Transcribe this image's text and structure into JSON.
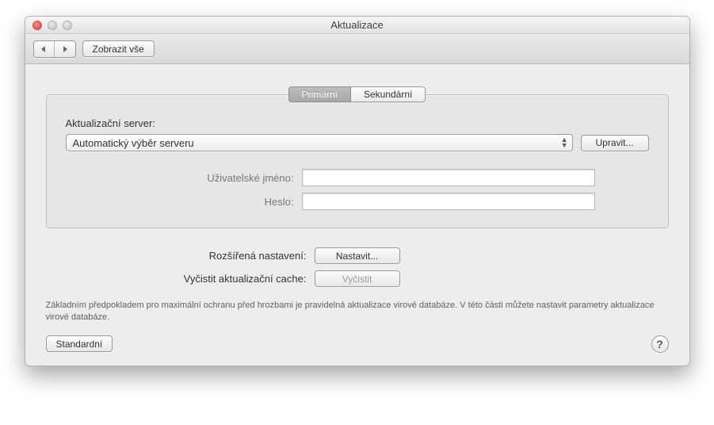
{
  "window": {
    "title": "Aktualizace"
  },
  "toolbar": {
    "show_all_label": "Zobrazit vše"
  },
  "tabs": {
    "primary": "Primární",
    "secondary": "Sekundární"
  },
  "panel": {
    "server_label": "Aktualizační server:",
    "server_value": "Automatický výběr serveru",
    "edit_label": "Upravit...",
    "username_label": "Uživatelské jméno:",
    "password_label": "Heslo:",
    "username_value": "",
    "password_value": ""
  },
  "lower": {
    "advanced_label": "Rozšířená nastavení:",
    "advanced_button": "Nastavit...",
    "clear_label": "Vyčistit aktualizační cache:",
    "clear_button": "Vyčistit"
  },
  "description": "Základním předpokladem pro maximální ochranu před hrozbami je pravidelná aktualizace virové databáze. V této části můžete nastavit parametry aktualizace virové databáze.",
  "footer": {
    "default_label": "Standardní",
    "help_symbol": "?"
  }
}
